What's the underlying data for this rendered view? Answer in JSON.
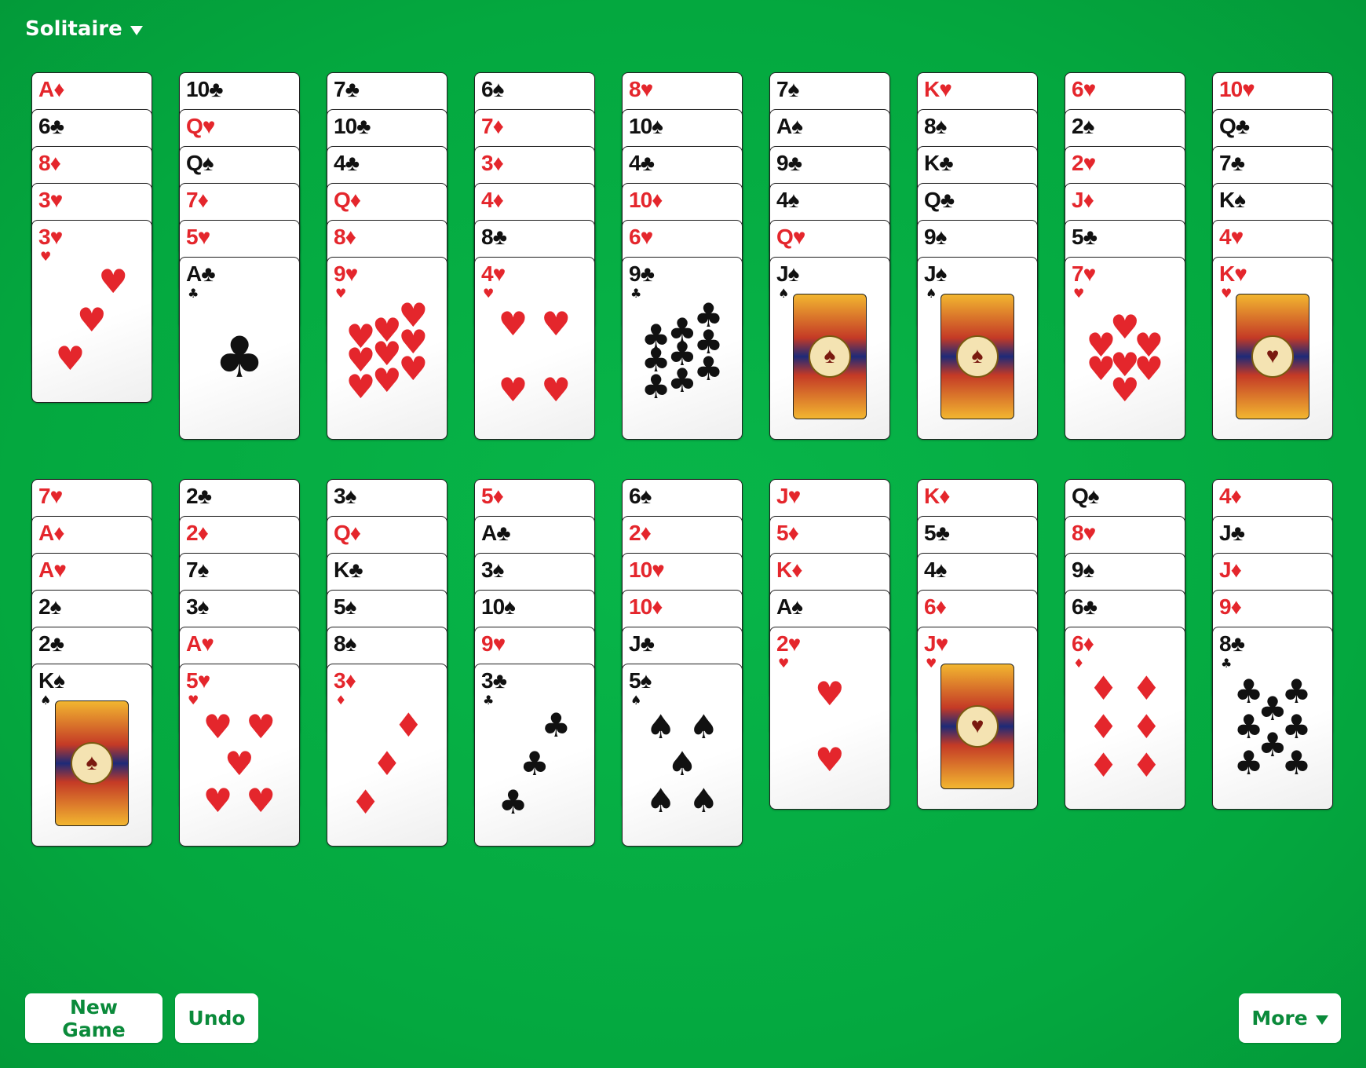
{
  "menu": {
    "title": "Solitaire"
  },
  "buttons": {
    "new_game": "New Game",
    "undo": "Undo",
    "more": "More"
  },
  "colors": {
    "felt": "#04a83f",
    "red_suit": "#e4262c",
    "black_suit": "#111111",
    "button_text": "#0a8a3a"
  },
  "suit_icons": {
    "hearts": "♥",
    "diamonds": "♦",
    "clubs": "♣",
    "spades": "♠"
  },
  "tableau": [
    [
      "A♦",
      "6♣",
      "8♦",
      "3♥",
      "3♥"
    ],
    [
      "10♣",
      "Q♥",
      "Q♠",
      "7♦",
      "5♥",
      "A♣"
    ],
    [
      "7♣",
      "10♣",
      "4♣",
      "Q♦",
      "8♦",
      "9♥"
    ],
    [
      "6♠",
      "7♦",
      "3♦",
      "4♦",
      "8♣",
      "4♥"
    ],
    [
      "8♥",
      "10♠",
      "4♣",
      "10♦",
      "6♥",
      "9♣"
    ],
    [
      "7♠",
      "A♠",
      "9♣",
      "4♠",
      "Q♥",
      "J♠"
    ],
    [
      "K♥",
      "8♠",
      "K♣",
      "Q♣",
      "9♠",
      "J♠"
    ],
    [
      "6♥",
      "2♠",
      "2♥",
      "J♦",
      "5♣",
      "7♥"
    ],
    [
      "10♥",
      "Q♣",
      "7♣",
      "K♠",
      "4♥",
      "K♥"
    ],
    [
      "7♥",
      "A♦",
      "A♥",
      "2♠",
      "2♣",
      "K♠"
    ],
    [
      "2♣",
      "2♦",
      "7♠",
      "3♠",
      "A♥",
      "5♥"
    ],
    [
      "3♠",
      "Q♦",
      "K♣",
      "5♠",
      "8♠",
      "3♦"
    ],
    [
      "5♦",
      "A♣",
      "3♠",
      "10♠",
      "9♥",
      "3♣"
    ],
    [
      "6♠",
      "2♦",
      "10♥",
      "10♦",
      "J♣",
      "5♠"
    ],
    [
      "J♥",
      "5♦",
      "K♦",
      "A♠",
      "2♥"
    ],
    [
      "K♦",
      "5♣",
      "4♠",
      "6♦",
      "J♥"
    ],
    [
      "Q♠",
      "8♥",
      "9♠",
      "6♣",
      "6♦"
    ],
    [
      "4♦",
      "J♣",
      "J♦",
      "9♦",
      "8♣"
    ]
  ]
}
